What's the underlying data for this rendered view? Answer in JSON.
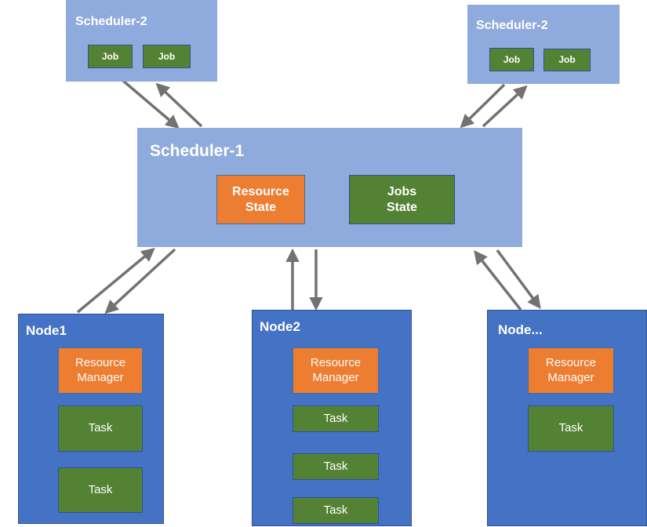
{
  "colors": {
    "scheduler_fill": "#8faadc",
    "node_fill": "#4472c4",
    "job_task_fill": "#548235",
    "resource_fill": "#ed7d31",
    "arrow": "#767171",
    "text": "#ffffff"
  },
  "schedulers_secondary": [
    {
      "title": "Scheduler-2",
      "jobs": [
        "Job",
        "Job"
      ]
    },
    {
      "title": "Scheduler-2",
      "jobs": [
        "Job",
        "Job"
      ]
    }
  ],
  "scheduler_primary": {
    "title": "Scheduler-1",
    "resource_state": "Resource\nState",
    "jobs_state": "Jobs\nState"
  },
  "nodes": [
    {
      "title": "Node1",
      "resource_manager": "Resource\nManager",
      "tasks": [
        "Task",
        "Task"
      ]
    },
    {
      "title": "Node2",
      "resource_manager": "Resource\nManager",
      "tasks": [
        "Task",
        "Task",
        "Task"
      ]
    },
    {
      "title": "Node...",
      "resource_manager": "Resource\nManager",
      "tasks": [
        "Task"
      ]
    }
  ],
  "connections": [
    {
      "from": "Scheduler-2 (left)",
      "to": "Scheduler-1",
      "direction": "bidirectional"
    },
    {
      "from": "Scheduler-2 (right)",
      "to": "Scheduler-1",
      "direction": "bidirectional"
    },
    {
      "from": "Scheduler-1",
      "to": "Node1",
      "direction": "bidirectional"
    },
    {
      "from": "Scheduler-1",
      "to": "Node2",
      "direction": "bidirectional"
    },
    {
      "from": "Scheduler-1",
      "to": "Node...",
      "direction": "bidirectional"
    }
  ]
}
